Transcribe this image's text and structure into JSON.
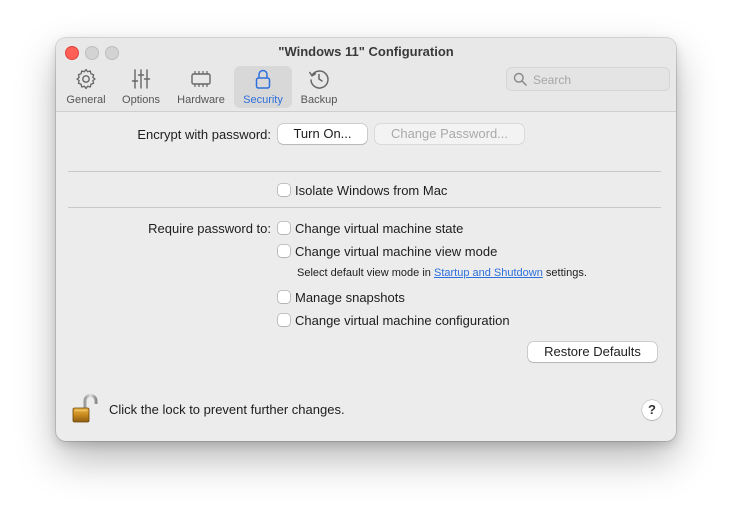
{
  "window": {
    "title": "\"Windows 11\" Configuration"
  },
  "toolbar": {
    "tabs": [
      {
        "label": "General",
        "icon": "gear-icon"
      },
      {
        "label": "Options",
        "icon": "sliders-icon"
      },
      {
        "label": "Hardware",
        "icon": "chip-icon"
      },
      {
        "label": "Security",
        "icon": "lock-icon",
        "active": true
      },
      {
        "label": "Backup",
        "icon": "clock-arrow-icon"
      }
    ],
    "search_placeholder": "Search",
    "accent_color": "#2d6fdc"
  },
  "security": {
    "encrypt_label": "Encrypt with password:",
    "turn_on_label": "Turn On...",
    "change_password_label": "Change Password...",
    "isolate_label": "Isolate Windows from Mac",
    "require_label": "Require password to:",
    "options": [
      {
        "label": "Change virtual machine state",
        "checked": false
      },
      {
        "label": "Change virtual machine view mode",
        "checked": false
      },
      {
        "label": "Manage snapshots",
        "checked": false
      },
      {
        "label": "Change virtual machine configuration",
        "checked": false
      }
    ],
    "view_mode_note_prefix": "Select default view mode in",
    "view_mode_note_link": "Startup and Shutdown",
    "view_mode_note_suffix": "settings.",
    "restore_defaults_label": "Restore Defaults"
  },
  "footer": {
    "lock_text": "Click the lock to prevent further changes.",
    "help_label": "?"
  }
}
